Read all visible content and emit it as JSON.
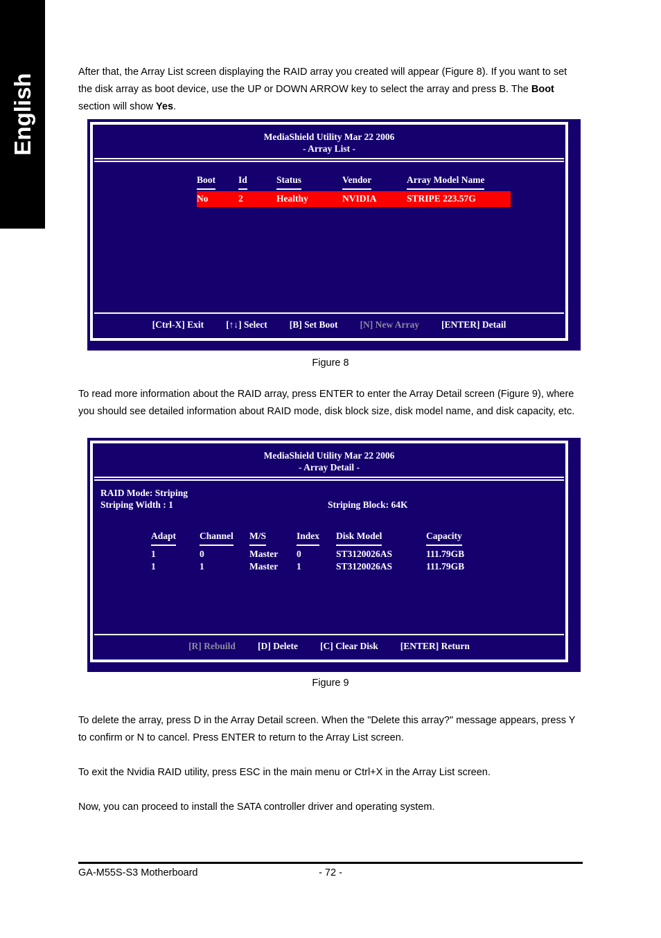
{
  "sidebar": {
    "language_tab": "English"
  },
  "paragraphs": {
    "p1": "After that, the Array List screen displaying the RAID array you created will appear (Figure 8). If you want to set the disk array as boot device, use the UP or DOWN ARROW key to select the array and press B. The Boot section will show Yes.",
    "p1_part_a": "After that, the Array List screen displaying the RAID array you created will appear (Figure 8). If you want to set the disk array as boot device, use the UP or DOWN ARROW key to select the array and press B. The ",
    "p1_bold_1": "Boot",
    "p1_part_b": " section will show ",
    "p1_bold_2": "Yes",
    "p1_part_c": ".",
    "p2": "To read more information about the RAID array, press ENTER to enter the Array Detail screen (Figure 9), where you should see detailed information about RAID mode, disk block size, disk model name, and disk capacity, etc.",
    "p3": "To delete the array, press D in the Array Detail screen. When the \"Delete this array?\" message appears, press Y to confirm or N to cancel. Press ENTER to return to the Array List screen.",
    "p4": "To exit the Nvidia RAID utility, press ESC in the main menu or Ctrl+X in the Array List screen.",
    "p5": "Now, you can proceed to install the SATA controller driver and operating system."
  },
  "figure_captions": {
    "fig8": "Figure 8",
    "fig9": "Figure 9"
  },
  "array_list_screen": {
    "title": "MediaShield Utility  Mar  22 2006",
    "subtitle": "- Array List -",
    "columns": [
      "Boot",
      "Id",
      "Status",
      "Vendor",
      "Array Model Name"
    ],
    "rows": [
      {
        "boot": "No",
        "id": "2",
        "status": "Healthy",
        "vendor": "NVIDIA",
        "model": "STRIPE   223.57G",
        "highlighted": true
      }
    ],
    "keys": [
      {
        "label": "[Ctrl-X] Exit",
        "disabled": false
      },
      {
        "label": "[↑↓] Select",
        "disabled": false
      },
      {
        "label": "[B] Set Boot",
        "disabled": false
      },
      {
        "label": "[N] New Array",
        "disabled": true
      },
      {
        "label": "[ENTER] Detail",
        "disabled": false
      }
    ]
  },
  "array_detail_screen": {
    "title": "MediaShield Utility  Mar  22 2006",
    "subtitle": "- Array Detail -",
    "fields": {
      "raid_mode": "RAID Mode:   Striping",
      "striping_width": "Striping Width : 1",
      "striping_block": "Striping Block: 64K"
    },
    "columns": [
      "Adapt",
      "Channel",
      "M/S",
      "Index",
      "Disk Model",
      "Capacity"
    ],
    "rows": [
      {
        "adapt": "1",
        "channel": "0",
        "ms": "Master",
        "index": "0",
        "model": "ST3120026AS",
        "capacity": "111.79GB"
      },
      {
        "adapt": "1",
        "channel": "1",
        "ms": "Master",
        "index": "1",
        "model": "ST3120026AS",
        "capacity": "111.79GB"
      }
    ],
    "keys": [
      {
        "label": "[R] Rebuild",
        "disabled": true
      },
      {
        "label": "[D] Delete",
        "disabled": false
      },
      {
        "label": "[C] Clear Disk",
        "disabled": false
      },
      {
        "label": "[ENTER] Return",
        "disabled": false
      }
    ]
  },
  "footer": {
    "product": "GA-M55S-S3 Motherboard",
    "page_number": "- 72 -"
  },
  "colors": {
    "bios_background": "#16006E",
    "highlight_row": "#FF0000",
    "bios_text": "#FFFFFF",
    "disabled_key": "#8C8C9E",
    "sidebar_background": "#000000"
  }
}
